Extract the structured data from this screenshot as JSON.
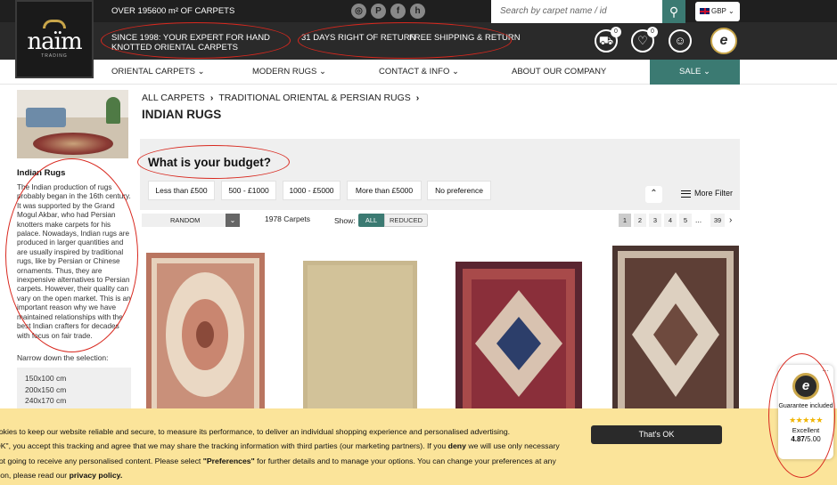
{
  "topbar": {
    "area_text": "OVER 195600 m² OF CARPETS",
    "expert_text": "SINCE 1998: YOUR EXPERT FOR HAND KNOTTED ORIENTAL CARPETS",
    "return_text": "31 DAYS RIGHT OF RETURN",
    "shipping_text": "FREE SHIPPING & RETURN",
    "search_placeholder": "Search by carpet name / id",
    "currency": "GBP",
    "cart_count": "0",
    "wishlist_count": "0",
    "social_icons": [
      "instagram-icon",
      "pinterest-icon",
      "facebook-icon",
      "houzz-icon"
    ]
  },
  "logo": {
    "word": "naïm",
    "sub": "TRADING"
  },
  "nav": {
    "items": [
      "ORIENTAL CARPETS",
      "MODERN RUGS",
      "CONTACT & INFO",
      "ABOUT OUR COMPANY"
    ],
    "sale": "SALE"
  },
  "sidebar": {
    "title": "Indian Rugs",
    "description": "The Indian production of rugs probably began in the 16th century. It was supported by the Grand Mogul Akbar, who had Persian knotters make carpets for his palace. Nowadays, Indian rugs are produced in larger quantities and are usually inspired by traditional rugs, like by Persian or Chinese ornaments. Thus, they are inexpensive alternatives to Persian carpets. However, their quality can vary on the open market. This is an important reason why we have maintained relationships with the best Indian crafters for decades with focus on fair trade.",
    "narrow_label": "Narrow down the selection:",
    "sizes": [
      "150x100 cm",
      "200x150 cm",
      "240x170 cm"
    ]
  },
  "breadcrumb": [
    "ALL CARPETS",
    "TRADITIONAL ORIENTAL & PERSIAN RUGS"
  ],
  "page_title": "INDIAN RUGS",
  "budget": {
    "question": "What is your budget?",
    "options": [
      "Less than £500",
      "500 - £1000",
      "1000 - £5000",
      "More than £5000",
      "No preference"
    ],
    "more_filter": "More Filter"
  },
  "listing": {
    "sort": "RANDOM",
    "count": "1978  Carpets",
    "show_label": "Show:",
    "show_all": "ALL",
    "show_reduced": "REDUCED",
    "pages": [
      "1",
      "2",
      "3",
      "4",
      "5"
    ],
    "dots": "...",
    "last_page": "39"
  },
  "cookie": {
    "line1": "ookies to keep our website reliable and secure, to measure its performance, to deliver an individual shopping experience and personalised advertising.",
    "line2a": "OK\", you accept this tracking and agree that we may share the tracking information with third parties (our marketing partners). If you ",
    "deny": "deny",
    "line2b": " we will use only necessary",
    "line3a": "not going to receive any personalised content. Please select ",
    "preferences": "\"Preferences\"",
    "line3b": " for further details and to manage your options. You can change your preferences at any",
    "line4a": "ition, please read our ",
    "privacy": "privacy policy.",
    "ok_button": "That's OK"
  },
  "trusted": {
    "guarantee": "Guarantee included",
    "stars": "★★★★★",
    "rating_word": "Excellent",
    "score": "4.87",
    "score_max": "/5.00"
  },
  "colors": {
    "accent": "#3b7a72",
    "dark": "#2a2a2a",
    "cookie_bg": "#fbe49a",
    "annotation": "#d8281e"
  }
}
